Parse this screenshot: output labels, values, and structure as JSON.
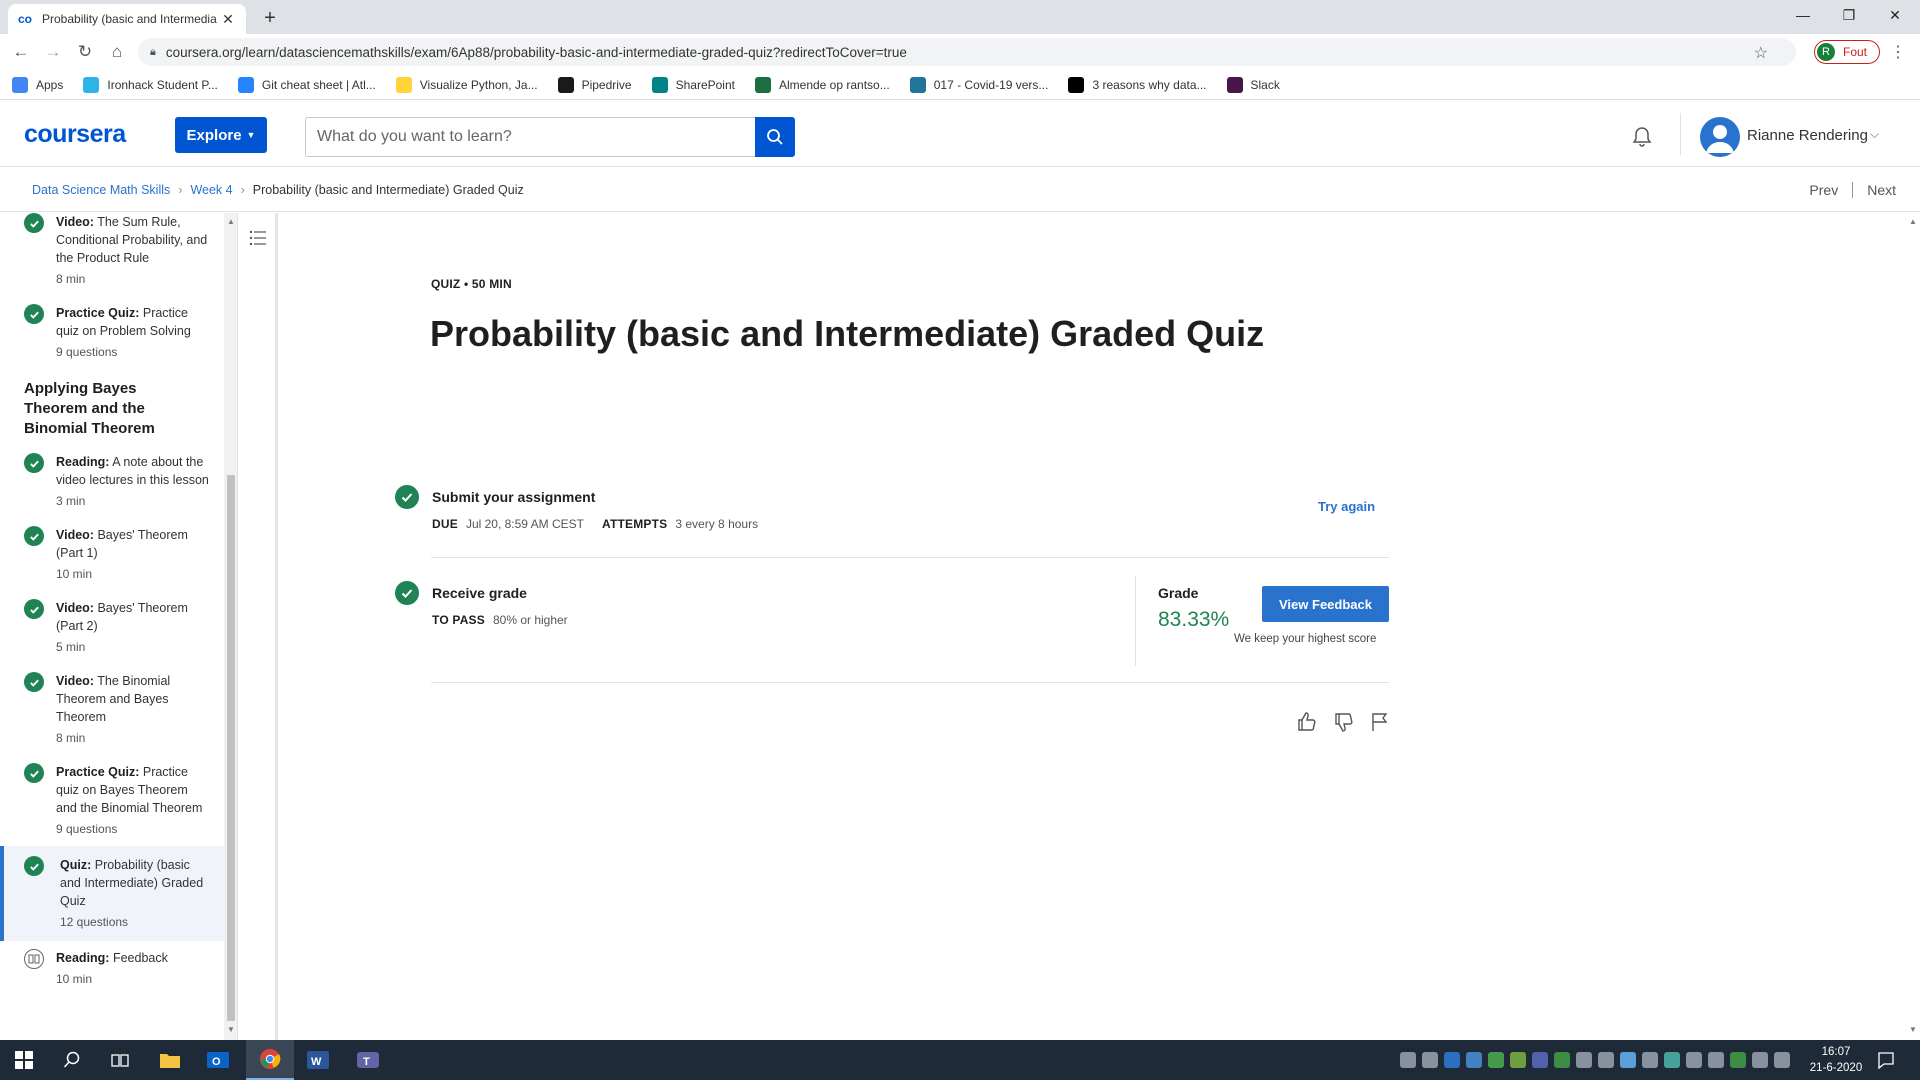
{
  "browser": {
    "tab_title": "Probability (basic and Intermedia",
    "url": "coursera.org/learn/datasciencemathskills/exam/6Ap88/probability-basic-and-intermediate-graded-quiz?redirectToCover=true",
    "profile_initial": "R",
    "profile_label": "Fout",
    "bookmarks": [
      {
        "label": "Apps",
        "color": "#4285f4",
        "icon": "apps-grid-icon"
      },
      {
        "label": "Ironhack Student P...",
        "color": "#2bb5e8",
        "icon": "ironhack-icon"
      },
      {
        "label": "Git cheat sheet | Atl...",
        "color": "#2684ff",
        "icon": "atlassian-icon"
      },
      {
        "label": "Visualize Python, Ja...",
        "color": "#ffd43b",
        "icon": "python-icon"
      },
      {
        "label": "Pipedrive",
        "color": "#1a1a1a",
        "icon": "pipedrive-icon"
      },
      {
        "label": "SharePoint",
        "color": "#038387",
        "icon": "sharepoint-icon"
      },
      {
        "label": "Almende op rantso...",
        "color": "#1d6f42",
        "icon": "excel-icon"
      },
      {
        "label": "017 - Covid-19 vers...",
        "color": "#21759b",
        "icon": "wordpress-icon"
      },
      {
        "label": "3 reasons why data...",
        "color": "#000000",
        "icon": "medium-icon"
      },
      {
        "label": "Slack",
        "color": "#4a154b",
        "icon": "slack-icon"
      }
    ]
  },
  "header": {
    "logo": "coursera",
    "explore": "Explore",
    "search_placeholder": "What do you want to learn?",
    "user_name": "Rianne Rendering"
  },
  "breadcrumb": {
    "items": [
      "Data Science Math Skills",
      "Week 4"
    ],
    "current": "Probability (basic and Intermediate) Graded Quiz",
    "prev": "Prev",
    "next": "Next"
  },
  "sidebar": {
    "items_top": [
      {
        "type": "Video:",
        "title": "The Sum Rule, Conditional Probability, and the Product Rule",
        "meta": "8 min"
      },
      {
        "type": "Practice Quiz:",
        "title": "Practice quiz on Problem Solving",
        "meta": "9 questions"
      }
    ],
    "module_title": "Applying Bayes Theorem and the Binomial Theorem",
    "items": [
      {
        "type": "Reading:",
        "title": "A note about the video lectures in this lesson",
        "meta": "3 min"
      },
      {
        "type": "Video:",
        "title": "Bayes' Theorem (Part 1)",
        "meta": "10 min"
      },
      {
        "type": "Video:",
        "title": "Bayes' Theorem (Part 2)",
        "meta": "5 min"
      },
      {
        "type": "Video:",
        "title": "The Binomial Theorem and Bayes Theorem",
        "meta": "8 min"
      },
      {
        "type": "Practice Quiz:",
        "title": "Practice quiz on Bayes Theorem and the Binomial Theorem",
        "meta": "9 questions"
      },
      {
        "type": "Quiz:",
        "title": "Probability (basic and Intermediate) Graded Quiz",
        "meta": "12 questions"
      },
      {
        "type": "Reading:",
        "title": "Feedback",
        "meta": "10 min"
      }
    ]
  },
  "main": {
    "kicker": "QUIZ • 50 MIN",
    "title": "Probability (basic and Intermediate) Graded Quiz",
    "submit": {
      "heading": "Submit your assignment",
      "due_label": "DUE",
      "due_value": "Jul 20, 8:59 AM CEST",
      "attempts_label": "ATTEMPTS",
      "attempts_value": "3 every 8 hours",
      "try_again": "Try again"
    },
    "receive": {
      "heading": "Receive grade",
      "pass_label": "TO PASS",
      "pass_value": "80% or higher",
      "grade_label": "Grade",
      "grade_value": "83.33%",
      "view_feedback": "View Feedback",
      "note": "We keep your highest score"
    }
  },
  "taskbar": {
    "time": "16:07",
    "date": "21-6-2020"
  }
}
